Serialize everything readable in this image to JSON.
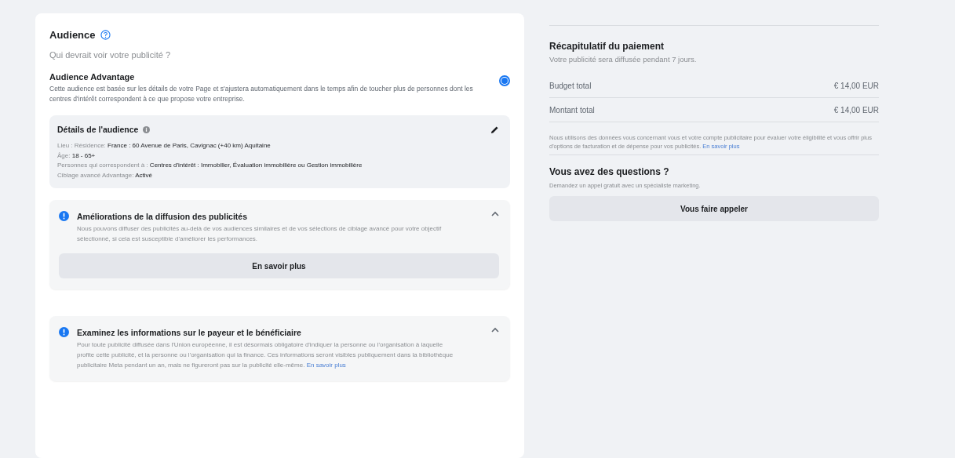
{
  "audience": {
    "title": "Audience",
    "subtitle": "Qui devrait voir votre publicité ?",
    "options": [
      {
        "title": "Audience Advantage",
        "description": "Cette audience est basée sur les détails de votre Page et s'ajustera automatiquement dans le temps afin de toucher plus de personnes dont les centres d'intérêt correspondent à ce que propose votre entreprise.",
        "selected": true
      }
    ],
    "details": {
      "title": "Détails de l'audience",
      "lines": [
        {
          "label": "Lieu : Résidence:",
          "value": "France : 60 Avenue de Paris, Cavignac (+40 km) Aquitaine"
        },
        {
          "label": "Âge:",
          "value": "18 - 65+"
        },
        {
          "label": "Personnes qui correspondent à :",
          "value": "Centres d'intérêt : Immobilier, Évaluation immobilière ou Gestion immobilière"
        },
        {
          "label": "Ciblage avancé Advantage:",
          "value": "Activé"
        }
      ]
    },
    "notices": [
      {
        "title": "Améliorations de la diffusion des publicités",
        "text": "Nous pouvons diffuser des publicités au-delà de vos audiences similaires et de vos sélections de ciblage avancé pour votre objectif sélectionné, si cela est susceptible d'améliorer les performances.",
        "button": "En savoir plus",
        "expanded": true
      },
      {
        "title": "Examinez les informations sur le payeur et le bénéficiaire",
        "text": "Pour toute publicité diffusée dans l'Union européenne, il est désormais obligatoire d'indiquer la personne ou l'organisation à laquelle profite cette publicité, et la personne ou l'organisation qui la finance. Ces informations seront visibles publiquement dans la bibliothèque publicitaire Meta pendant un an, mais ne figureront pas sur la publicité elle-même.",
        "link": "En savoir plus",
        "expanded": true
      }
    ]
  },
  "payment_summary": {
    "title": "Récapitulatif du paiement",
    "subtitle": "Votre publicité sera diffusée pendant 7 jours.",
    "rows": [
      {
        "label": "Budget total",
        "value": "€ 14,00 EUR"
      },
      {
        "label": "Montant total",
        "value": "€ 14,00 EUR"
      }
    ],
    "note": "Nous utilisons des données vous concernant vous et votre compte publicitaire pour évaluer votre éligibilité et vous offrir plus d'options de facturation et de dépense pour vos publicités.",
    "note_link": "En savoir plus"
  },
  "questions": {
    "title": "Vous avez des questions ?",
    "subtitle": "Demandez un appel gratuit avec un spécialiste marketing.",
    "button": "Vous faire appeler"
  }
}
